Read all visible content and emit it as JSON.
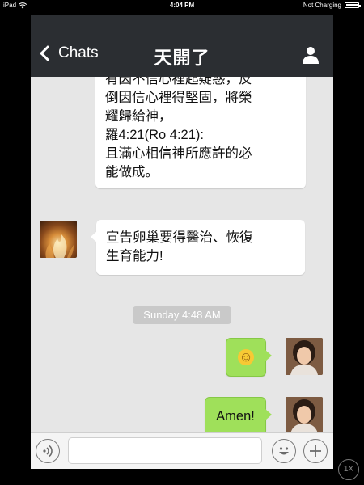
{
  "status_bar": {
    "carrier": "iPad",
    "time": "4:04 PM",
    "charging": "Not Charging"
  },
  "nav": {
    "back_label": "Chats",
    "title": "天開了"
  },
  "messages": [
    {
      "direction": "incoming",
      "text": "有因不信心裡起疑惑，反\n倒因信心裡得堅固，將榮\n耀歸給神，\n羅4:21(Ro 4:21):\n且滿心相信神所應許的必\n能做成。"
    },
    {
      "direction": "incoming",
      "text": "宣告卵巢要得醫治、恢復\n生育能力!"
    },
    {
      "direction": "outgoing",
      "emoji": "☺"
    },
    {
      "direction": "outgoing",
      "text": "Amen!"
    }
  ],
  "timestamp": "Sunday 4:48 AM",
  "input": {
    "placeholder": "",
    "value": ""
  },
  "zoom_label": "1X",
  "colors": {
    "nav_bg": "#2b2e32",
    "chat_bg": "#e6e6e6",
    "outgoing_bubble": "#9fe05a",
    "incoming_bubble": "#ffffff"
  }
}
